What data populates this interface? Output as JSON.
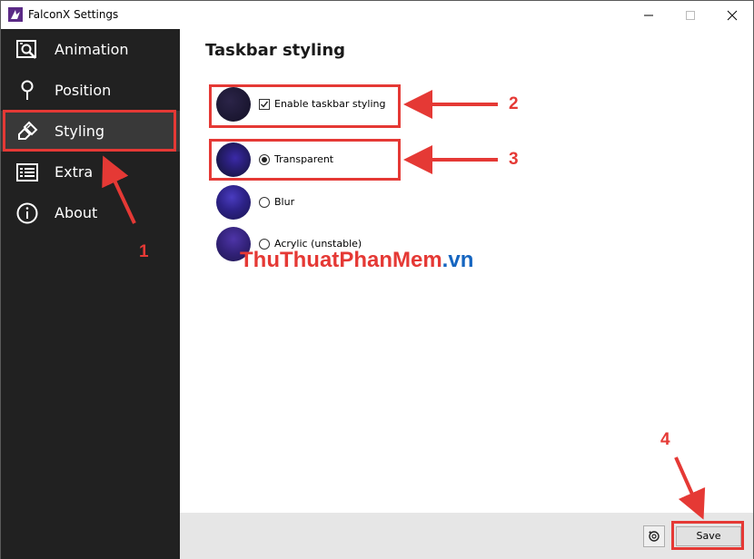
{
  "window": {
    "title": "FalconX Settings"
  },
  "sidebar": {
    "items": [
      {
        "label": "Animation",
        "icon": "animation-icon"
      },
      {
        "label": "Position",
        "icon": "pin-icon"
      },
      {
        "label": "Styling",
        "icon": "brush-icon",
        "selected": true
      },
      {
        "label": "Extra",
        "icon": "list-icon"
      },
      {
        "label": "About",
        "icon": "info-icon"
      }
    ]
  },
  "main": {
    "title": "Taskbar styling",
    "enable_label": "Enable taskbar styling",
    "enable_checked": true,
    "options": [
      {
        "label": "Transparent",
        "checked": true
      },
      {
        "label": "Blur",
        "checked": false
      },
      {
        "label": "Acrylic (unstable)",
        "checked": false
      }
    ]
  },
  "footer": {
    "save_label": "Save",
    "reset_icon": "reset-icon"
  },
  "annotations": {
    "numbers": [
      "1",
      "2",
      "3",
      "4"
    ],
    "color": "#e53935"
  },
  "watermark": {
    "part1": "ThuThuat",
    "part2": "PhanMem",
    "part3": ".vn"
  },
  "colors": {
    "sidebar_bg": "#212121",
    "sidebar_selected": "#393939",
    "footer_bg": "#e6e6e6"
  }
}
